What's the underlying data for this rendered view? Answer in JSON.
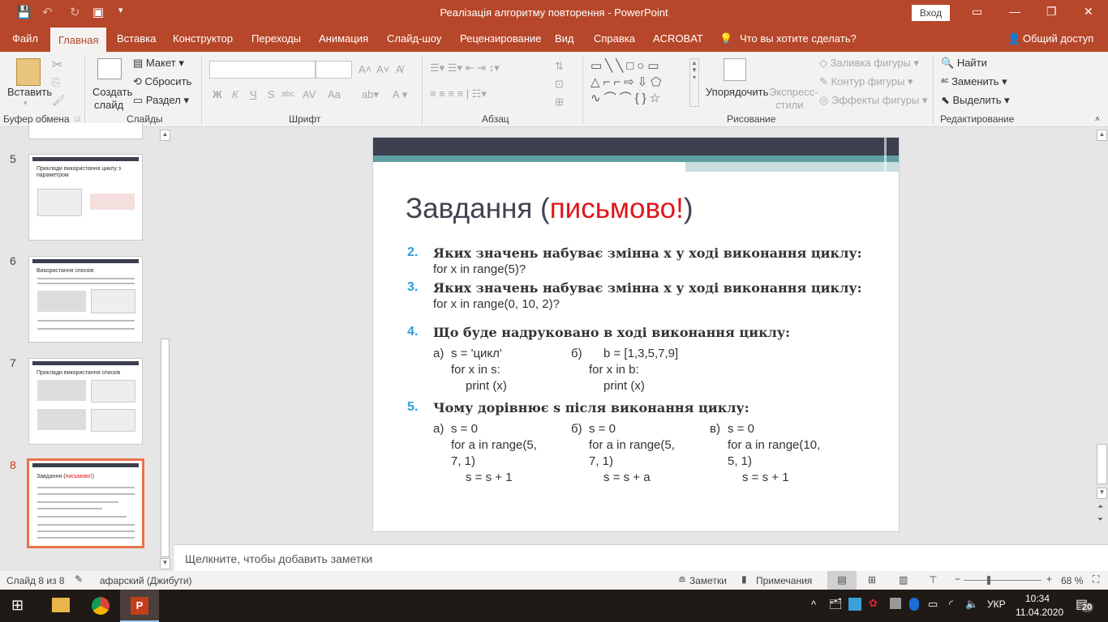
{
  "window": {
    "title": "Реалізація алгоритму повторення  -  PowerPoint",
    "login": "Вход"
  },
  "menu": {
    "tabs": [
      "Файл",
      "Главная",
      "Вставка",
      "Конструктор",
      "Переходы",
      "Анимация",
      "Слайд-шоу",
      "Рецензирование",
      "Вид",
      "Справка",
      "ACROBAT"
    ],
    "active": "Главная",
    "tell_me": "Что вы хотите сделать?",
    "share": "Общий доступ"
  },
  "ribbon": {
    "clipboard": {
      "paste": "Вставить",
      "label": "Буфер обмена"
    },
    "slides": {
      "new_slide_1": "Создать",
      "new_slide_2": "слайд",
      "layout": "Макет",
      "reset": "Сбросить",
      "section": "Раздел",
      "label": "Слайды"
    },
    "font": {
      "label": "Шрифт",
      "font_name": "",
      "font_size": "",
      "bold": "Ж",
      "italic": "К",
      "underline": "Ч",
      "shadow": "S",
      "strike": "abc",
      "spacing": "AV",
      "case": "Aa"
    },
    "paragraph": {
      "label": "Абзац"
    },
    "drawing": {
      "arrange": "Упорядочить",
      "quick_styles_1": "Экспресс-",
      "quick_styles_2": "стили",
      "fill": "Заливка фигуры",
      "outline": "Контур фигуры",
      "effects": "Эффекты фигуры",
      "label": "Рисование"
    },
    "editing": {
      "find": "Найти",
      "replace": "Заменить",
      "select": "Выделить",
      "label": "Редактирование"
    }
  },
  "thumbnails": [
    {
      "num": "5",
      "title": "Приклади використання циклу з параметром"
    },
    {
      "num": "6",
      "title": "Використання списків"
    },
    {
      "num": "7",
      "title": "Приклади використання списків"
    },
    {
      "num": "8",
      "title": "Завдання (",
      "title_red": "письмово!",
      "title_end": ")",
      "selected": true
    }
  ],
  "slide": {
    "title": "Завдання (",
    "title_red": "письмово!",
    "title_end": ")",
    "colors": {
      "title": "#404250",
      "accent_red": "#e0151b",
      "number": "#2a9fd8",
      "header": "#3b3f4e",
      "teal": "#5f9ea0"
    },
    "questions": [
      {
        "num": "2.",
        "text": "Яких значень набуває змінна x у ході виконання циклу:",
        "code": "for x in range(5)?"
      },
      {
        "num": "3.",
        "text": "Яких значень набуває змінна x у ході виконання циклу:",
        "code": "for x in range(0, 10, 2)?"
      },
      {
        "num": "4.",
        "text": "Що буде надруковано в ході виконання циклу:",
        "parts": [
          {
            "label": "а)",
            "lines": [
              "s = 'цикл'",
              "for x in s:",
              "print (x)"
            ]
          },
          {
            "label": "б)",
            "lines": [
              "b = [1,3,5,7,9]",
              "for x in b:",
              "print (x)"
            ]
          }
        ]
      },
      {
        "num": "5.",
        "text": "Чому дорівнює s після виконання циклу:",
        "parts": [
          {
            "label": "а)",
            "lines": [
              "s = 0",
              "for a in range(5,",
              "7, 1)",
              "s = s + 1"
            ]
          },
          {
            "label": "б)",
            "lines": [
              "s = 0",
              "for a in range(5,",
              "7, 1)",
              "s = s + a"
            ]
          },
          {
            "label": "в)",
            "lines": [
              "s = 0",
              "for a in range(10,",
              "5, 1)",
              "s = s + 1"
            ]
          }
        ]
      }
    ]
  },
  "notes": {
    "placeholder": "Щелкните, чтобы добавить заметки"
  },
  "status": {
    "slide": "Слайд 8 из 8",
    "language": "афарский (Джибути)",
    "notes": "Заметки",
    "comments": "Примечания",
    "zoom": "68 %",
    "zoom_percent": 68
  },
  "taskbar": {
    "lang": "УКР",
    "time": "10:34",
    "date": "11.04.2020",
    "notifications": "20"
  }
}
